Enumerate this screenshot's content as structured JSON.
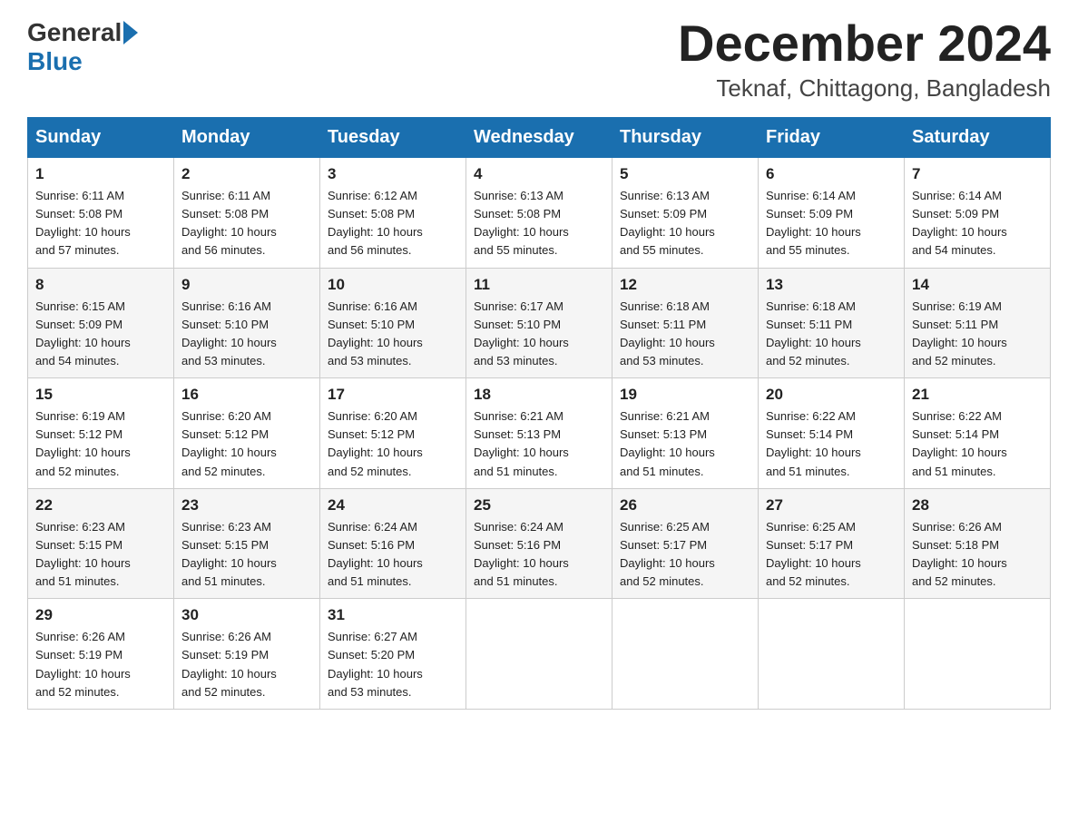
{
  "header": {
    "logo_general": "General",
    "logo_blue": "Blue",
    "month_title": "December 2024",
    "location": "Teknaf, Chittagong, Bangladesh"
  },
  "days_of_week": [
    "Sunday",
    "Monday",
    "Tuesday",
    "Wednesday",
    "Thursday",
    "Friday",
    "Saturday"
  ],
  "weeks": [
    [
      {
        "day": "1",
        "sunrise": "6:11 AM",
        "sunset": "5:08 PM",
        "daylight": "10 hours and 57 minutes."
      },
      {
        "day": "2",
        "sunrise": "6:11 AM",
        "sunset": "5:08 PM",
        "daylight": "10 hours and 56 minutes."
      },
      {
        "day": "3",
        "sunrise": "6:12 AM",
        "sunset": "5:08 PM",
        "daylight": "10 hours and 56 minutes."
      },
      {
        "day": "4",
        "sunrise": "6:13 AM",
        "sunset": "5:08 PM",
        "daylight": "10 hours and 55 minutes."
      },
      {
        "day": "5",
        "sunrise": "6:13 AM",
        "sunset": "5:09 PM",
        "daylight": "10 hours and 55 minutes."
      },
      {
        "day": "6",
        "sunrise": "6:14 AM",
        "sunset": "5:09 PM",
        "daylight": "10 hours and 55 minutes."
      },
      {
        "day": "7",
        "sunrise": "6:14 AM",
        "sunset": "5:09 PM",
        "daylight": "10 hours and 54 minutes."
      }
    ],
    [
      {
        "day": "8",
        "sunrise": "6:15 AM",
        "sunset": "5:09 PM",
        "daylight": "10 hours and 54 minutes."
      },
      {
        "day": "9",
        "sunrise": "6:16 AM",
        "sunset": "5:10 PM",
        "daylight": "10 hours and 53 minutes."
      },
      {
        "day": "10",
        "sunrise": "6:16 AM",
        "sunset": "5:10 PM",
        "daylight": "10 hours and 53 minutes."
      },
      {
        "day": "11",
        "sunrise": "6:17 AM",
        "sunset": "5:10 PM",
        "daylight": "10 hours and 53 minutes."
      },
      {
        "day": "12",
        "sunrise": "6:18 AM",
        "sunset": "5:11 PM",
        "daylight": "10 hours and 53 minutes."
      },
      {
        "day": "13",
        "sunrise": "6:18 AM",
        "sunset": "5:11 PM",
        "daylight": "10 hours and 52 minutes."
      },
      {
        "day": "14",
        "sunrise": "6:19 AM",
        "sunset": "5:11 PM",
        "daylight": "10 hours and 52 minutes."
      }
    ],
    [
      {
        "day": "15",
        "sunrise": "6:19 AM",
        "sunset": "5:12 PM",
        "daylight": "10 hours and 52 minutes."
      },
      {
        "day": "16",
        "sunrise": "6:20 AM",
        "sunset": "5:12 PM",
        "daylight": "10 hours and 52 minutes."
      },
      {
        "day": "17",
        "sunrise": "6:20 AM",
        "sunset": "5:12 PM",
        "daylight": "10 hours and 52 minutes."
      },
      {
        "day": "18",
        "sunrise": "6:21 AM",
        "sunset": "5:13 PM",
        "daylight": "10 hours and 51 minutes."
      },
      {
        "day": "19",
        "sunrise": "6:21 AM",
        "sunset": "5:13 PM",
        "daylight": "10 hours and 51 minutes."
      },
      {
        "day": "20",
        "sunrise": "6:22 AM",
        "sunset": "5:14 PM",
        "daylight": "10 hours and 51 minutes."
      },
      {
        "day": "21",
        "sunrise": "6:22 AM",
        "sunset": "5:14 PM",
        "daylight": "10 hours and 51 minutes."
      }
    ],
    [
      {
        "day": "22",
        "sunrise": "6:23 AM",
        "sunset": "5:15 PM",
        "daylight": "10 hours and 51 minutes."
      },
      {
        "day": "23",
        "sunrise": "6:23 AM",
        "sunset": "5:15 PM",
        "daylight": "10 hours and 51 minutes."
      },
      {
        "day": "24",
        "sunrise": "6:24 AM",
        "sunset": "5:16 PM",
        "daylight": "10 hours and 51 minutes."
      },
      {
        "day": "25",
        "sunrise": "6:24 AM",
        "sunset": "5:16 PM",
        "daylight": "10 hours and 51 minutes."
      },
      {
        "day": "26",
        "sunrise": "6:25 AM",
        "sunset": "5:17 PM",
        "daylight": "10 hours and 52 minutes."
      },
      {
        "day": "27",
        "sunrise": "6:25 AM",
        "sunset": "5:17 PM",
        "daylight": "10 hours and 52 minutes."
      },
      {
        "day": "28",
        "sunrise": "6:26 AM",
        "sunset": "5:18 PM",
        "daylight": "10 hours and 52 minutes."
      }
    ],
    [
      {
        "day": "29",
        "sunrise": "6:26 AM",
        "sunset": "5:19 PM",
        "daylight": "10 hours and 52 minutes."
      },
      {
        "day": "30",
        "sunrise": "6:26 AM",
        "sunset": "5:19 PM",
        "daylight": "10 hours and 52 minutes."
      },
      {
        "day": "31",
        "sunrise": "6:27 AM",
        "sunset": "5:20 PM",
        "daylight": "10 hours and 53 minutes."
      },
      null,
      null,
      null,
      null
    ]
  ],
  "labels": {
    "sunrise": "Sunrise:",
    "sunset": "Sunset:",
    "daylight": "Daylight:"
  }
}
